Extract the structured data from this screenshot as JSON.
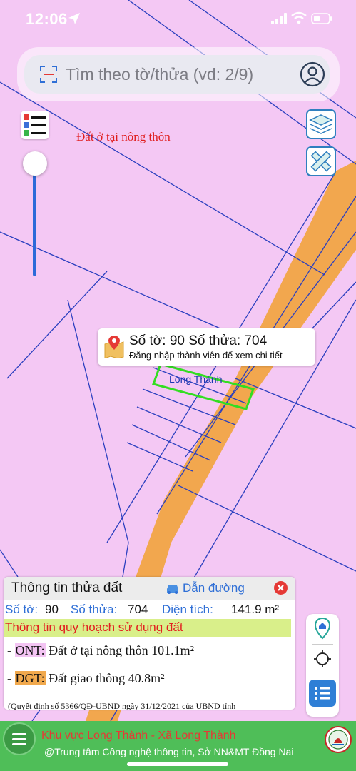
{
  "status_bar": {
    "time": "12:06"
  },
  "search": {
    "placeholder": "Tìm theo tờ/thửa (vd: 2/9)"
  },
  "map": {
    "zone_label": "Đất ở tại nông thôn",
    "parcel_label": "Long Thành",
    "colors": {
      "residential": "#f4c8f4",
      "road": "#f2a74e",
      "boundary": "#2a3fbf",
      "selected_parcel": "#33dd22"
    }
  },
  "popup": {
    "title": "Số tờ: 90 Số thửa: 704",
    "subtitle": "Đăng nhập thành viên để xem chi tiết"
  },
  "panel": {
    "title": "Thông tin thửa đất",
    "directions_label": "Dẫn đường",
    "sheet_label": "Số tờ:",
    "sheet_value": "90",
    "parcel_label": "Số thửa:",
    "parcel_value": "704",
    "area_label": "Diện tích:",
    "area_value": "141.9 m²",
    "plan_title": "Thông tin quy hoạch sử dụng đất",
    "plans": [
      {
        "prefix": "- ",
        "code": "ONT:",
        "text": " Đất ở tại nông thôn 101.1m²"
      },
      {
        "prefix": "- ",
        "code": "DGT:",
        "text": " Đất giao thông 40.8m²"
      }
    ],
    "note": "(Quyết định số 5366/QĐ-UBND ngày 31/12/2021 của UBND tỉnh"
  },
  "footer": {
    "line1": "Khu vực Long Thành - Xã Long Thành",
    "line2": "@Trung tâm Công nghệ thông tin, Sở NN&MT Đồng Nai"
  },
  "icons": {
    "status": [
      "location-arrow-icon",
      "signal-icon",
      "wifi-icon",
      "battery-icon"
    ],
    "controls": [
      "scan-icon",
      "user-icon",
      "legend-icon",
      "layers-icon",
      "measure-icon",
      "map-pin-icon",
      "car-icon",
      "close-icon",
      "home-pin-icon",
      "locate-icon",
      "list-icon",
      "menu-icon",
      "logo"
    ]
  }
}
